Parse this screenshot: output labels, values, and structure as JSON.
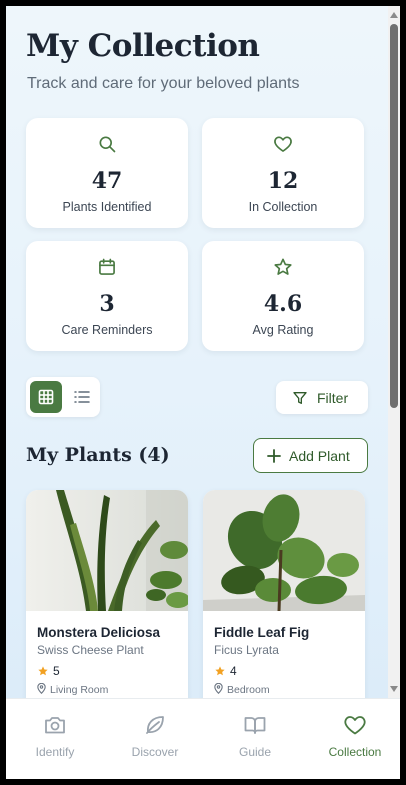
{
  "header": {
    "title": "My Collection",
    "subtitle": "Track and care for your beloved plants"
  },
  "stats": [
    {
      "icon": "search-icon",
      "value": "47",
      "label": "Plants Identified"
    },
    {
      "icon": "heart-icon",
      "value": "12",
      "label": "In Collection"
    },
    {
      "icon": "calendar-icon",
      "value": "3",
      "label": "Care Reminders"
    },
    {
      "icon": "star-icon",
      "value": "4.6",
      "label": "Avg Rating"
    }
  ],
  "toolbar": {
    "view_active": "grid",
    "filter_label": "Filter"
  },
  "plants_section": {
    "title": "My Plants (4)",
    "add_label": "Add Plant"
  },
  "plants": [
    {
      "name": "Monstera Deliciosa",
      "scientific": "Swiss Cheese Plant",
      "rating": "5",
      "location": "Living Room"
    },
    {
      "name": "Fiddle Leaf Fig",
      "scientific": "Ficus Lyrata",
      "rating": "4",
      "location": "Bedroom"
    }
  ],
  "nav": [
    {
      "label": "Identify",
      "icon": "camera-icon",
      "active": false
    },
    {
      "label": "Discover",
      "icon": "leaf-icon",
      "active": false
    },
    {
      "label": "Guide",
      "icon": "book-icon",
      "active": false
    },
    {
      "label": "Collection",
      "icon": "heart-icon",
      "active": true
    }
  ],
  "colors": {
    "accent": "#4a7a42",
    "star": "#f2a122",
    "text_dark": "#1d2633",
    "text_muted": "#6c7683",
    "nav_inactive": "#9aa3ad"
  }
}
